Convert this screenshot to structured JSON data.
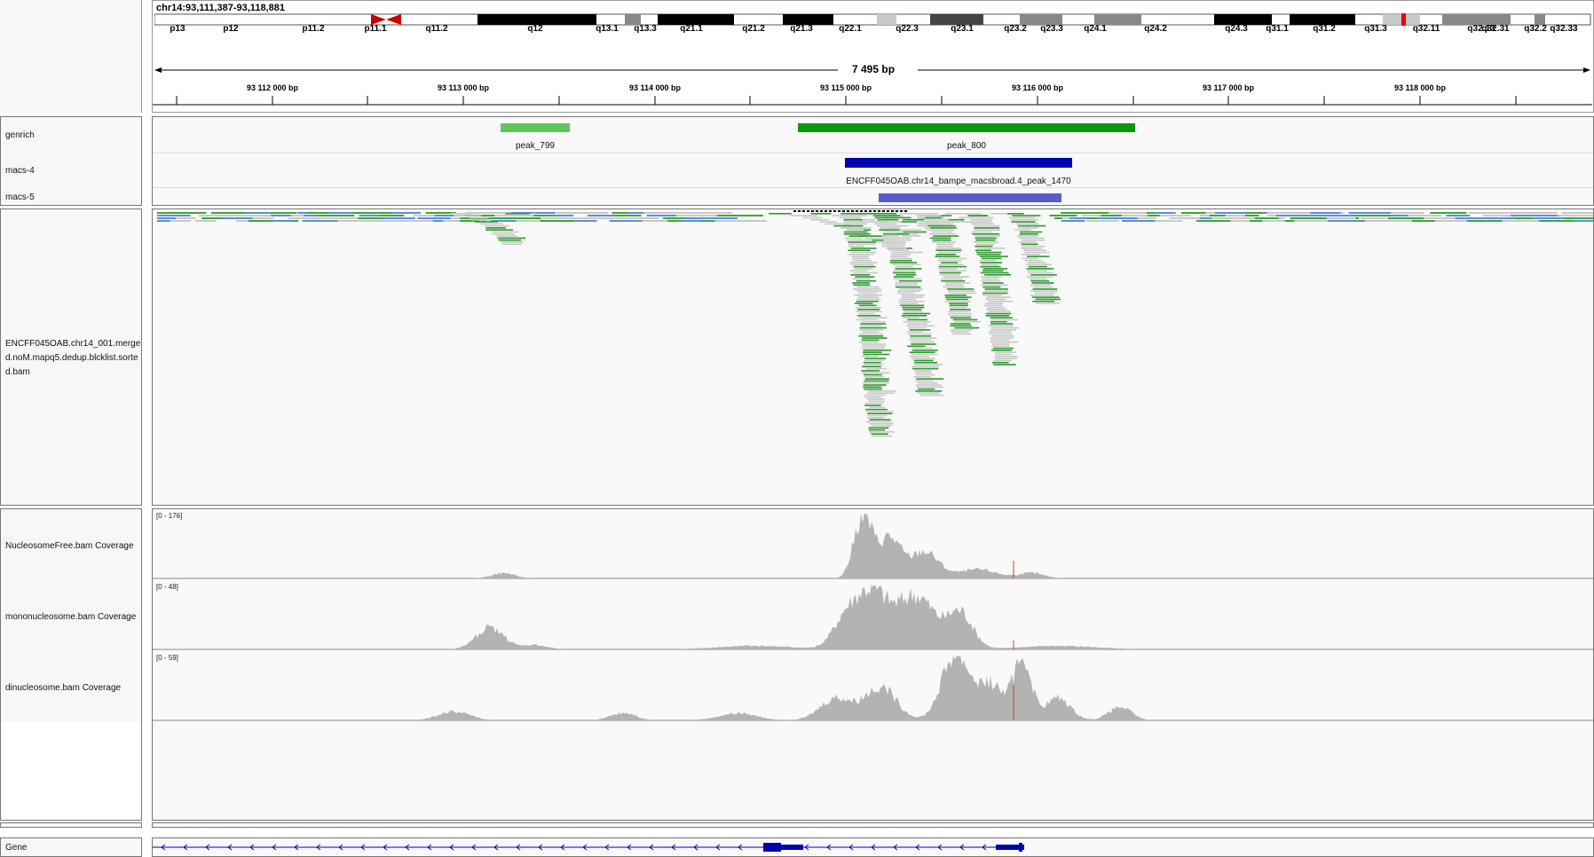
{
  "locus": "chr14:93,111,387-93,118,881",
  "span_label": "7 495 bp",
  "ideogram_bands": [
    "p13",
    "p12",
    "p11.2",
    "p11.1",
    "q11.2",
    "q12",
    "q13.1",
    "q13.3",
    "q21.1",
    "q21.2",
    "q21.3",
    "q22.1",
    "q22.3",
    "q23.1",
    "q23.2",
    "q23.3",
    "q24.1",
    "q24.2",
    "q24.3",
    "q31.1",
    "q31.2",
    "q31.3",
    "q32.11",
    "q32.13",
    "q32.2",
    "q32.31",
    "q32.33"
  ],
  "ruler_ticks": [
    "93 112 000 bp",
    "93 113 000 bp",
    "93 114 000 bp",
    "93 115 000 bp",
    "93 116 000 bp",
    "93 117 000 bp",
    "93 118 000 bp"
  ],
  "tracks": {
    "genrich": {
      "name": "genrich",
      "features": [
        "peak_799",
        "peak_800"
      ],
      "color": "#1aa51a"
    },
    "macs4": {
      "name": "macs-4",
      "feature": "ENCFF045OAB.chr14_bampe_macsbroad.4_peak_1470",
      "color": "#0000b3"
    },
    "macs5": {
      "name": "macs-5",
      "color": "#5a5acb"
    },
    "alignment": {
      "name": "ENCFF045OAB.chr14_001.merged.noM.mapq5.dedup.blcklist.sorted.bam"
    },
    "nfree": {
      "name": "NucleosomeFree.bam Coverage",
      "range": "[0 - 176]"
    },
    "mono": {
      "name": "mononucleosome.bam Coverage",
      "range": "[0 - 48]"
    },
    "di": {
      "name": "dinucleosome.bam Coverage",
      "range": "[0 - 59]"
    },
    "gene": {
      "name": "Gene"
    }
  },
  "colors": {
    "coverage": "#b3b3b3",
    "read": "#c8c8c8",
    "read_green": "#2c9a2c",
    "gene": "#0000b3"
  }
}
